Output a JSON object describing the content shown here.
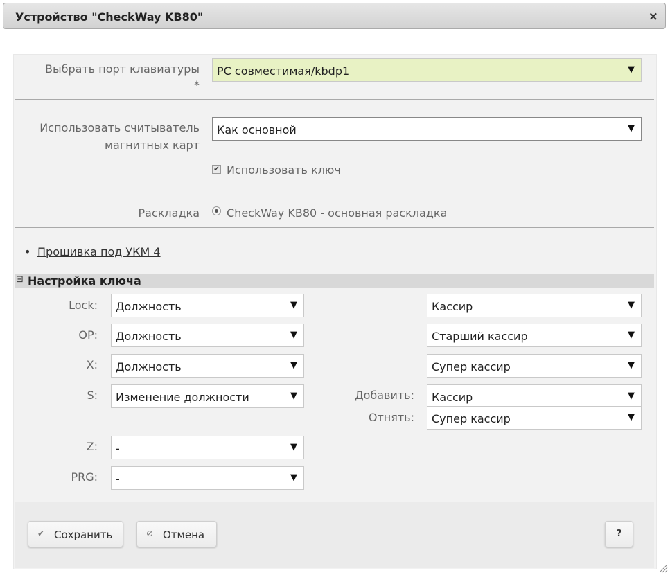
{
  "dialog": {
    "title": "Устройство \"CheckWay KB80\"",
    "close_icon": "×"
  },
  "port": {
    "label_line1": "Выбрать порт клавиатуры",
    "label_required": "*",
    "value": "PC совместимая/kbdp1",
    "highlight_color": "#e8f2c4"
  },
  "magcard": {
    "label_line1": "Использовать считыватель",
    "label_line2": "магнитных карт",
    "value": "Как основной",
    "use_key_checked": true,
    "use_key_label": "Использовать ключ"
  },
  "layout": {
    "label": "Раскладка",
    "option": "CheckWay KB80 - основная раскладка",
    "selected": true
  },
  "firmware_link": "Прошивка под УКМ 4",
  "key_settings": {
    "section_icon": "⊟",
    "section_title": "Настройка ключа",
    "rows": [
      {
        "label": "Lock:",
        "value": "Должность",
        "right_value": "Кассир"
      },
      {
        "label": "OP:",
        "value": "Должность",
        "right_value": "Старший кассир"
      },
      {
        "label": "X:",
        "value": "Должность",
        "right_value": "Супер кассир"
      },
      {
        "label": "S:",
        "value": "Изменение должности",
        "add_label": "Добавить:",
        "add_value": "Кассир",
        "remove_label": "Отнять:",
        "remove_value": "Супер кассир"
      },
      {
        "label": "Z:",
        "value": "-"
      },
      {
        "label": "PRG:",
        "value": "-"
      }
    ]
  },
  "buttons": {
    "save_icon": "✔",
    "save": "Сохранить",
    "cancel_icon": "⊘",
    "cancel": "Отмена",
    "help": "?"
  },
  "glyphs": {
    "arrow": "▼",
    "check": "✔"
  }
}
